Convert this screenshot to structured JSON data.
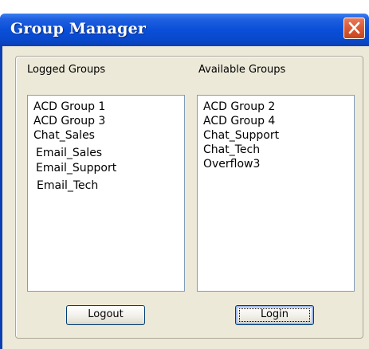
{
  "window": {
    "title": "Group Manager"
  },
  "logged": {
    "label": "Logged Groups",
    "items": [
      "ACD Group 1",
      "ACD Group 3",
      "Chat_Sales",
      "Email_Sales",
      "Email_Support",
      "Email_Tech"
    ],
    "button_label": "Logout"
  },
  "available": {
    "label": "Available Groups",
    "items": [
      "ACD Group 2",
      "ACD Group 4",
      "Chat_Support",
      "Chat_Tech",
      "Overflow3"
    ],
    "button_label": "Login"
  },
  "colors": {
    "titlebar": "#0a4fd8",
    "close_button": "#d85a34",
    "dialog_background": "#ece9d8",
    "listbox_border": "#7f9db9"
  },
  "icons": {
    "close": "close-icon"
  }
}
